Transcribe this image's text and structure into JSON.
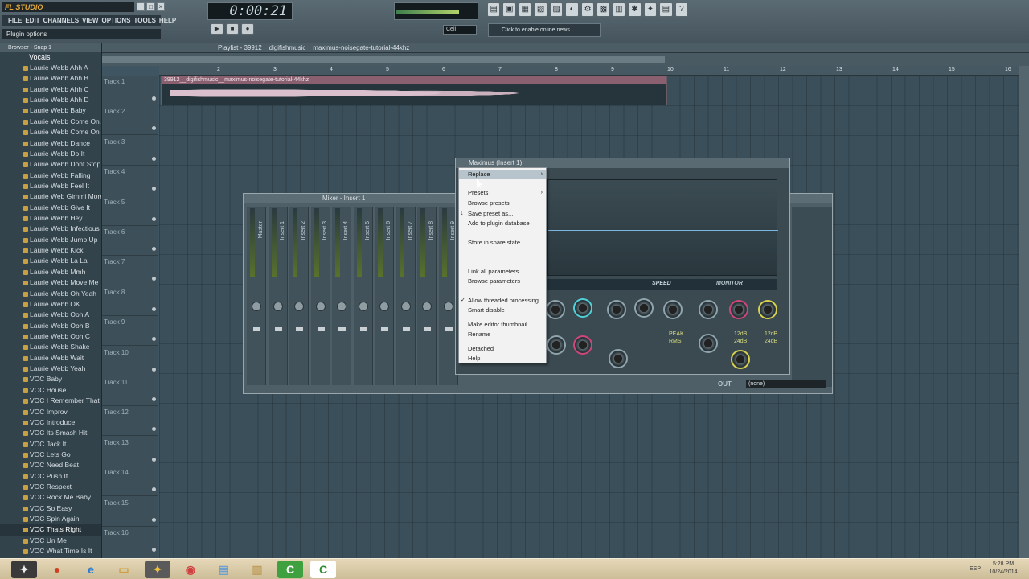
{
  "app": {
    "logo": "FL STUDIO",
    "time": "0:00:21",
    "hint": "Plugin options",
    "news": "Click to enable online news",
    "song_mode": "Cell"
  },
  "menus": [
    "FILE",
    "EDIT",
    "CHANNELS",
    "VIEW",
    "OPTIONS",
    "TOOLS",
    "HELP"
  ],
  "transport": [
    "▶",
    "■",
    "●"
  ],
  "toolbar_icons": [
    "▤",
    "▣",
    "▦",
    "▧",
    "▨",
    "◐",
    "⚙",
    "▩",
    "▥",
    "✱",
    "✦",
    "▤",
    "?"
  ],
  "browser": {
    "title": "Browser - Snap 1",
    "folder": "Vocals",
    "items": [
      "Laurie Webb Ahh A",
      "Laurie Webb Ahh B",
      "Laurie Webb Ahh C",
      "Laurie Webb Ahh D",
      "Laurie Webb Baby",
      "Laurie Webb Come On A",
      "Laurie Webb Come On B",
      "Laurie Webb Dance",
      "Laurie Webb Do It",
      "Laurie Webb Dont Stop",
      "Laurie Webb Falling",
      "Laurie Webb Feel It",
      "Laurie Web Gimmi More",
      "Laurie Webb Give It",
      "Laurie Webb Hey",
      "Laurie Webb Infectious",
      "Laurie Webb Jump Up",
      "Laurie Webb Kick",
      "Laurie Webb La La",
      "Laurie Webb Mmh",
      "Laurie Webb Move Me",
      "Laurie Webb Oh Yeah",
      "Laurie Webb OK",
      "Laurie Webb Ooh A",
      "Laurie Webb Ooh B",
      "Laurie Webb Ooh C",
      "Laurie Webb Shake",
      "Laurie Webb Wait",
      "Laurie Webb Yeah",
      "VOC Baby",
      "VOC House",
      "VOC I Remember That",
      "VOC Improv",
      "VOC Introduce",
      "VOC Its Smash Hit",
      "VOC Jack It",
      "VOC Lets Go",
      "VOC Need Beat",
      "VOC Push It",
      "VOC Respect",
      "VOC Rock Me Baby",
      "VOC So Easy",
      "VOC Spin Again",
      "VOC Thats Right",
      "VOC Un Me",
      "VOC What Time Is It"
    ]
  },
  "playlist": {
    "title": "Playlist - 39912__digifishmusic__maximus-noisegate-tutorial-44khz",
    "clip_title": "39912__digifishmusic__maximus-noisegate-tutorial-44khz",
    "ruler": [
      "2",
      "3",
      "4",
      "5",
      "6",
      "7",
      "8",
      "9",
      "10",
      "11",
      "12",
      "13",
      "14",
      "15",
      "16"
    ],
    "tracks": [
      "Track 1",
      "Track 2",
      "Track 3",
      "Track 4",
      "Track 5",
      "Track 6",
      "Track 7",
      "Track 8",
      "Track 9",
      "Track 10",
      "Track 11",
      "Track 12",
      "Track 13",
      "Track 14",
      "Track 15",
      "Track 16"
    ]
  },
  "mixer": {
    "title": "Mixer - Insert 1",
    "strips": [
      "Master",
      "Insert 1",
      "Insert 2",
      "Insert 3",
      "Insert 4",
      "Insert 5",
      "Insert 6",
      "Insert 7",
      "Insert 8",
      "Insert 9"
    ],
    "out_label": "OUT",
    "out_value": "(none)"
  },
  "maximus": {
    "title": "Maximus (Insert 1)",
    "speed": "SPEED",
    "monitor": "MONITOR",
    "peak": "PEAK",
    "rms": "RMS",
    "db12a": "12dB",
    "db24a": "24dB",
    "db12b": "12dB",
    "db24b": "24dB"
  },
  "context_menu": [
    {
      "label": "Replace",
      "highlight": true,
      "arrow": true
    },
    {
      "label": "Presets",
      "arrow": true
    },
    {
      "label": "Browse presets"
    },
    {
      "label": "Save preset as...",
      "check": "↓"
    },
    {
      "label": "Add to plugin database"
    },
    {
      "label": "Store in spare state"
    },
    {
      "label": "Link all parameters..."
    },
    {
      "label": "Browse parameters"
    },
    {
      "label": "Allow threaded processing",
      "check": "✓"
    },
    {
      "label": "Smart disable"
    },
    {
      "label": "Make editor thumbnail"
    },
    {
      "label": "Rename"
    },
    {
      "label": "Detached"
    },
    {
      "label": "Help"
    }
  ],
  "taskbar": {
    "clock_time": "5:28 PM",
    "clock_date": "10/24/2014",
    "lang": "ESP"
  }
}
